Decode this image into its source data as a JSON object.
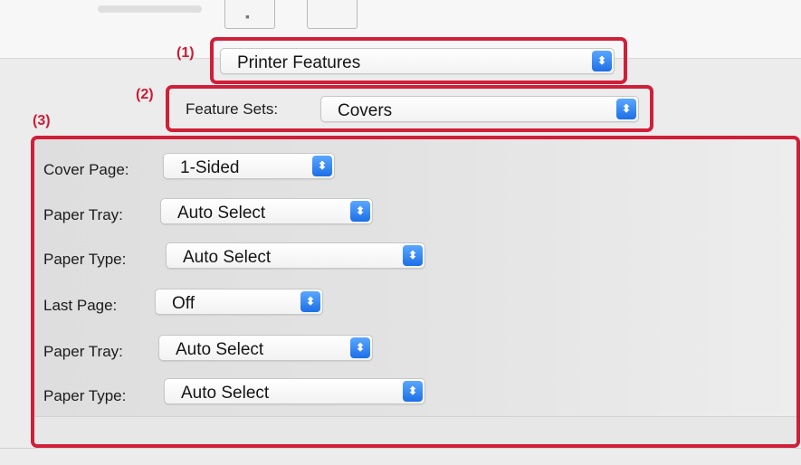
{
  "callouts": {
    "one": "(1)",
    "two": "(2)",
    "three": "(3)"
  },
  "top": {
    "panel_menu_value": "Printer Features"
  },
  "feature_sets": {
    "label": "Feature Sets:",
    "value": "Covers"
  },
  "settings": [
    {
      "label": "Cover Page:",
      "value": "1-Sided"
    },
    {
      "label": "Paper Tray:",
      "value": "Auto Select"
    },
    {
      "label": "Paper Type:",
      "value": "Auto Select"
    },
    {
      "label": "Last Page:",
      "value": "Off"
    },
    {
      "label": "Paper Tray:",
      "value": "Auto Select"
    },
    {
      "label": "Paper Type:",
      "value": "Auto Select"
    }
  ],
  "colors": {
    "highlight": "#d01f39",
    "accent": "#1d6fe6"
  },
  "icons": {
    "popup_arrow": "up-down-chevron-icon"
  }
}
